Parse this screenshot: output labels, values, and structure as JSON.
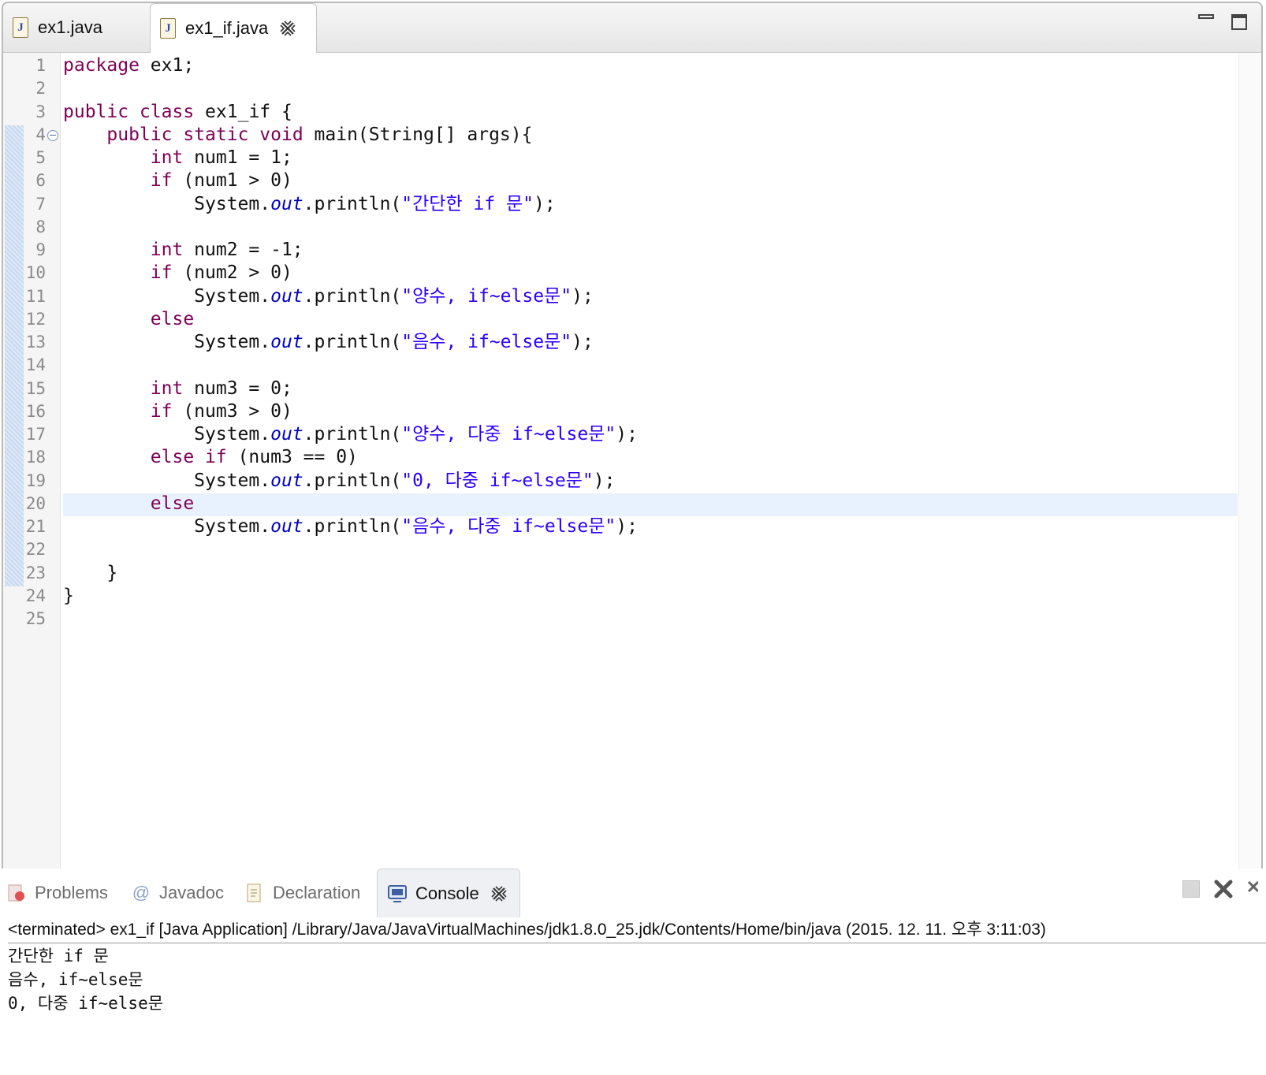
{
  "editor": {
    "tabs": [
      {
        "label": "ex1.java",
        "active": false
      },
      {
        "label": "ex1_if.java",
        "active": true
      }
    ],
    "lines": [
      {
        "n": "1",
        "tokens": [
          {
            "t": "kw",
            "v": "package"
          },
          {
            "t": "p",
            "v": " ex1;"
          }
        ]
      },
      {
        "n": "2",
        "tokens": []
      },
      {
        "n": "3",
        "tokens": [
          {
            "t": "kw",
            "v": "public"
          },
          {
            "t": "p",
            "v": " "
          },
          {
            "t": "kw",
            "v": "class"
          },
          {
            "t": "p",
            "v": " ex1_if {"
          }
        ]
      },
      {
        "n": "4",
        "tokens": [
          {
            "t": "p",
            "v": "    "
          },
          {
            "t": "kw",
            "v": "public"
          },
          {
            "t": "p",
            "v": " "
          },
          {
            "t": "kw",
            "v": "static"
          },
          {
            "t": "p",
            "v": " "
          },
          {
            "t": "kw",
            "v": "void"
          },
          {
            "t": "p",
            "v": " main(String[] args){"
          }
        ]
      },
      {
        "n": "5",
        "tokens": [
          {
            "t": "p",
            "v": "        "
          },
          {
            "t": "kw",
            "v": "int"
          },
          {
            "t": "p",
            "v": " num1 = 1;"
          }
        ]
      },
      {
        "n": "6",
        "tokens": [
          {
            "t": "p",
            "v": "        "
          },
          {
            "t": "kw",
            "v": "if"
          },
          {
            "t": "p",
            "v": " (num1 > 0)"
          }
        ]
      },
      {
        "n": "7",
        "tokens": [
          {
            "t": "p",
            "v": "            System."
          },
          {
            "t": "fld",
            "v": "out"
          },
          {
            "t": "p",
            "v": ".println("
          },
          {
            "t": "str",
            "v": "\"간단한 if 문\""
          },
          {
            "t": "p",
            "v": ");"
          }
        ]
      },
      {
        "n": "8",
        "tokens": []
      },
      {
        "n": "9",
        "tokens": [
          {
            "t": "p",
            "v": "        "
          },
          {
            "t": "kw",
            "v": "int"
          },
          {
            "t": "p",
            "v": " num2 = -1;"
          }
        ]
      },
      {
        "n": "10",
        "tokens": [
          {
            "t": "p",
            "v": "        "
          },
          {
            "t": "kw",
            "v": "if"
          },
          {
            "t": "p",
            "v": " (num2 > 0)"
          }
        ]
      },
      {
        "n": "11",
        "tokens": [
          {
            "t": "p",
            "v": "            System."
          },
          {
            "t": "fld",
            "v": "out"
          },
          {
            "t": "p",
            "v": ".println("
          },
          {
            "t": "str",
            "v": "\"양수, if~else문\""
          },
          {
            "t": "p",
            "v": ");"
          }
        ]
      },
      {
        "n": "12",
        "tokens": [
          {
            "t": "p",
            "v": "        "
          },
          {
            "t": "kw",
            "v": "else"
          }
        ]
      },
      {
        "n": "13",
        "tokens": [
          {
            "t": "p",
            "v": "            System."
          },
          {
            "t": "fld",
            "v": "out"
          },
          {
            "t": "p",
            "v": ".println("
          },
          {
            "t": "str",
            "v": "\"음수, if~else문\""
          },
          {
            "t": "p",
            "v": ");"
          }
        ]
      },
      {
        "n": "14",
        "tokens": []
      },
      {
        "n": "15",
        "tokens": [
          {
            "t": "p",
            "v": "        "
          },
          {
            "t": "kw",
            "v": "int"
          },
          {
            "t": "p",
            "v": " num3 = 0;"
          }
        ]
      },
      {
        "n": "16",
        "tokens": [
          {
            "t": "p",
            "v": "        "
          },
          {
            "t": "kw",
            "v": "if"
          },
          {
            "t": "p",
            "v": " (num3 > 0)"
          }
        ]
      },
      {
        "n": "17",
        "tokens": [
          {
            "t": "p",
            "v": "            System."
          },
          {
            "t": "fld",
            "v": "out"
          },
          {
            "t": "p",
            "v": ".println("
          },
          {
            "t": "str",
            "v": "\"양수, 다중 if~else문\""
          },
          {
            "t": "p",
            "v": ");"
          }
        ]
      },
      {
        "n": "18",
        "tokens": [
          {
            "t": "p",
            "v": "        "
          },
          {
            "t": "kw",
            "v": "else"
          },
          {
            "t": "p",
            "v": " "
          },
          {
            "t": "kw",
            "v": "if"
          },
          {
            "t": "p",
            "v": " (num3 == 0)"
          }
        ]
      },
      {
        "n": "19",
        "tokens": [
          {
            "t": "p",
            "v": "            System."
          },
          {
            "t": "fld",
            "v": "out"
          },
          {
            "t": "p",
            "v": ".println("
          },
          {
            "t": "str",
            "v": "\"0, 다중 if~else문\""
          },
          {
            "t": "p",
            "v": ");"
          }
        ]
      },
      {
        "n": "20",
        "tokens": [
          {
            "t": "p",
            "v": "        "
          },
          {
            "t": "kw",
            "v": "else"
          }
        ]
      },
      {
        "n": "21",
        "tokens": [
          {
            "t": "p",
            "v": "            System."
          },
          {
            "t": "fld",
            "v": "out"
          },
          {
            "t": "p",
            "v": ".println("
          },
          {
            "t": "str",
            "v": "\"음수, 다중 if~else문\""
          },
          {
            "t": "p",
            "v": ");"
          }
        ]
      },
      {
        "n": "22",
        "tokens": []
      },
      {
        "n": "23",
        "tokens": [
          {
            "t": "p",
            "v": "    }"
          }
        ]
      },
      {
        "n": "24",
        "tokens": [
          {
            "t": "p",
            "v": "}"
          }
        ]
      },
      {
        "n": "25",
        "tokens": []
      }
    ],
    "current_line": "20",
    "fold_line": "4"
  },
  "console": {
    "tabs": [
      {
        "label": "Problems",
        "icon": "problems-icon",
        "active": false
      },
      {
        "label": "Javadoc",
        "icon": "javadoc-icon",
        "active": false
      },
      {
        "label": "Declaration",
        "icon": "declaration-icon",
        "active": false
      },
      {
        "label": "Console",
        "icon": "console-icon",
        "active": true
      }
    ],
    "status": "<terminated> ex1_if [Java Application] /Library/Java/JavaVirtualMachines/jdk1.8.0_25.jdk/Contents/Home/bin/java (2015. 12. 11. 오후 3:11:03)",
    "output": [
      "간단한 if 문",
      "음수, if~else문",
      "0, 다중 if~else문"
    ]
  },
  "colors": {
    "keyword": "#7f0055",
    "string": "#2a00ff",
    "field": "#0000c0",
    "current_line": "#e8f2fe"
  }
}
